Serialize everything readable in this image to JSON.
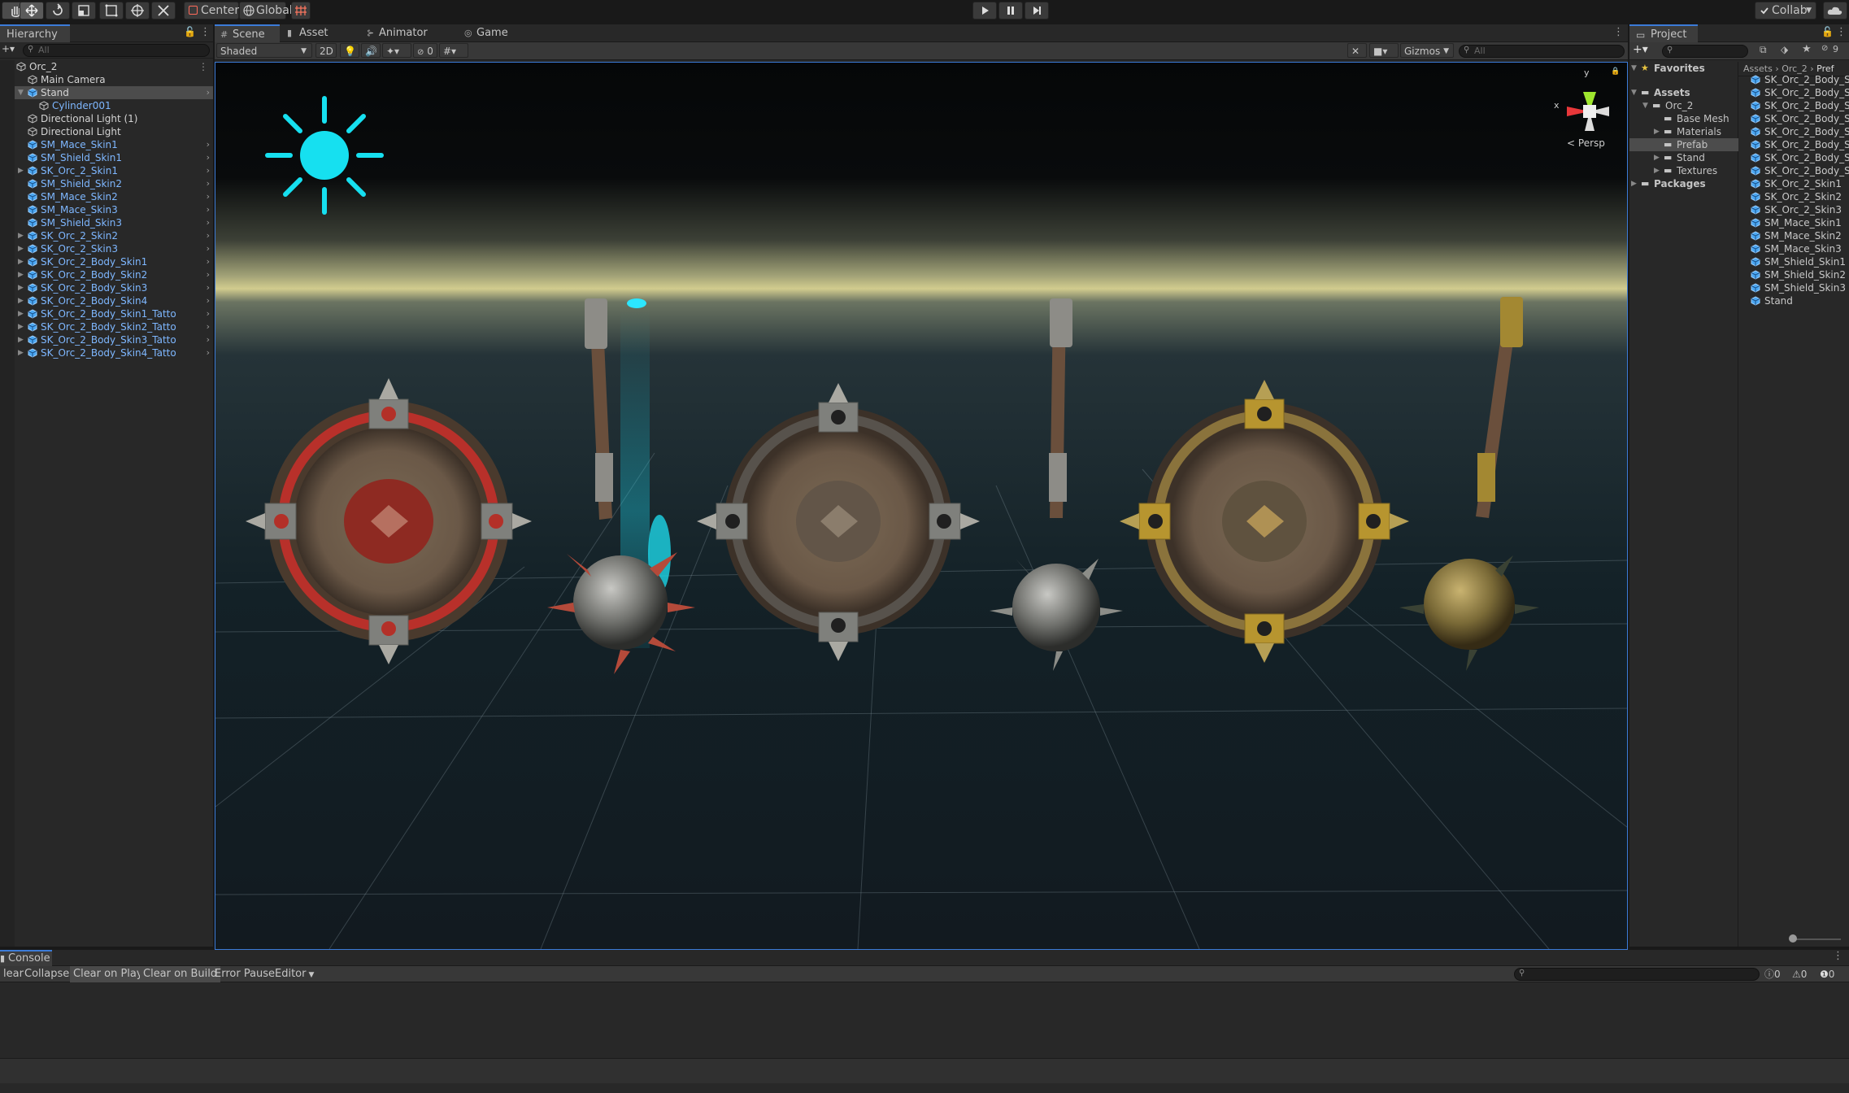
{
  "toolbar": {
    "tools": [
      "hand-tool",
      "move-tool",
      "rotate-tool",
      "scale-tool",
      "rect-tool",
      "transform-tool",
      "custom-tool"
    ],
    "pivot_label": "Center",
    "space_label": "Global",
    "collab_label": "Collab"
  },
  "hierarchy": {
    "tab_label": "Hierarchy",
    "search_placeholder": "All",
    "items": [
      {
        "label": "Orc_2",
        "indent": 0,
        "color": "white",
        "fold": "open",
        "icon": "scene"
      },
      {
        "label": "Main Camera",
        "indent": 1,
        "color": "white",
        "fold": "",
        "icon": "gameobject"
      },
      {
        "label": "Stand",
        "indent": 1,
        "color": "white",
        "fold": "open",
        "icon": "prefab",
        "selected": true,
        "arrow": true
      },
      {
        "label": "Cylinder001",
        "indent": 2,
        "color": "blue",
        "fold": "",
        "icon": "gameobject"
      },
      {
        "label": "Directional Light (1)",
        "indent": 1,
        "color": "white",
        "fold": "",
        "icon": "gameobject"
      },
      {
        "label": "Directional Light",
        "indent": 1,
        "color": "white",
        "fold": "",
        "icon": "gameobject"
      },
      {
        "label": "SM_Mace_Skin1",
        "indent": 1,
        "color": "blue",
        "fold": "",
        "icon": "prefab",
        "arrow": true
      },
      {
        "label": "SM_Shield_Skin1",
        "indent": 1,
        "color": "blue",
        "fold": "",
        "icon": "prefab",
        "arrow": true
      },
      {
        "label": "SK_Orc_2_Skin1",
        "indent": 1,
        "color": "blue",
        "fold": "closed",
        "icon": "prefab",
        "arrow": true
      },
      {
        "label": "SM_Shield_Skin2",
        "indent": 1,
        "color": "blue",
        "fold": "",
        "icon": "prefab",
        "arrow": true
      },
      {
        "label": "SM_Mace_Skin2",
        "indent": 1,
        "color": "blue",
        "fold": "",
        "icon": "prefab",
        "arrow": true
      },
      {
        "label": "SM_Mace_Skin3",
        "indent": 1,
        "color": "blue",
        "fold": "",
        "icon": "prefab",
        "arrow": true
      },
      {
        "label": "SM_Shield_Skin3",
        "indent": 1,
        "color": "blue",
        "fold": "",
        "icon": "prefab",
        "arrow": true
      },
      {
        "label": "SK_Orc_2_Skin2",
        "indent": 1,
        "color": "blue",
        "fold": "closed",
        "icon": "prefab",
        "arrow": true
      },
      {
        "label": "SK_Orc_2_Skin3",
        "indent": 1,
        "color": "blue",
        "fold": "closed",
        "icon": "prefab",
        "arrow": true
      },
      {
        "label": "SK_Orc_2_Body_Skin1",
        "indent": 1,
        "color": "blue",
        "fold": "closed",
        "icon": "prefab",
        "arrow": true
      },
      {
        "label": "SK_Orc_2_Body_Skin2",
        "indent": 1,
        "color": "blue",
        "fold": "closed",
        "icon": "prefab",
        "arrow": true
      },
      {
        "label": "SK_Orc_2_Body_Skin3",
        "indent": 1,
        "color": "blue",
        "fold": "closed",
        "icon": "prefab",
        "arrow": true
      },
      {
        "label": "SK_Orc_2_Body_Skin4",
        "indent": 1,
        "color": "blue",
        "fold": "closed",
        "icon": "prefab",
        "arrow": true
      },
      {
        "label": "SK_Orc_2_Body_Skin1_Tatto",
        "indent": 1,
        "color": "blue",
        "fold": "closed",
        "icon": "prefab",
        "arrow": true
      },
      {
        "label": "SK_Orc_2_Body_Skin2_Tatto",
        "indent": 1,
        "color": "blue",
        "fold": "closed",
        "icon": "prefab",
        "arrow": true
      },
      {
        "label": "SK_Orc_2_Body_Skin3_Tatto",
        "indent": 1,
        "color": "blue",
        "fold": "closed",
        "icon": "prefab",
        "arrow": true
      },
      {
        "label": "SK_Orc_2_Body_Skin4_Tatto",
        "indent": 1,
        "color": "blue",
        "fold": "closed",
        "icon": "prefab",
        "arrow": true
      }
    ]
  },
  "scene": {
    "tabs": [
      {
        "label": "Scene",
        "icon": "grid-icon",
        "active": true
      },
      {
        "label": "Asset Store",
        "icon": "store-icon",
        "active": false
      },
      {
        "label": "Animator",
        "icon": "animator-icon",
        "active": false
      },
      {
        "label": "Game",
        "icon": "game-icon",
        "active": false
      }
    ],
    "shading_mode": "Shaded",
    "mode_2d_label": "2D",
    "hidden_count": "0",
    "gizmos_label": "Gizmos",
    "search_placeholder": "All",
    "gizmo_axes": {
      "x": "x",
      "y": "y"
    },
    "projection_label": "Persp"
  },
  "project": {
    "tab_label": "Project",
    "badge_count": "9",
    "breadcrumb": [
      "Assets",
      "Orc_2",
      "Pref"
    ],
    "tree": [
      {
        "label": "Favorites",
        "indent": 0,
        "bold": true,
        "icon": "star-icon",
        "fold": "open"
      },
      {
        "label": "Assets",
        "indent": 0,
        "bold": true,
        "icon": "folder-icon",
        "fold": "open"
      },
      {
        "label": "Orc_2",
        "indent": 1,
        "bold": false,
        "icon": "folder-icon",
        "fold": "open"
      },
      {
        "label": "Base Mesh",
        "indent": 2,
        "bold": false,
        "icon": "folder-icon",
        "fold": ""
      },
      {
        "label": "Materials",
        "indent": 2,
        "bold": false,
        "icon": "folder-icon",
        "fold": "closed"
      },
      {
        "label": "Prefab",
        "indent": 2,
        "bold": false,
        "icon": "folder-icon",
        "fold": "",
        "selected": true
      },
      {
        "label": "Stand",
        "indent": 2,
        "bold": false,
        "icon": "folder-icon",
        "fold": "closed"
      },
      {
        "label": "Textures",
        "indent": 2,
        "bold": false,
        "icon": "folder-icon",
        "fold": "closed"
      },
      {
        "label": "Packages",
        "indent": 0,
        "bold": true,
        "icon": "folder-icon",
        "fold": "closed"
      }
    ],
    "assets": [
      "SK_Orc_2_Body_S",
      "SK_Orc_2_Body_S",
      "SK_Orc_2_Body_S",
      "SK_Orc_2_Body_S",
      "SK_Orc_2_Body_S",
      "SK_Orc_2_Body_S",
      "SK_Orc_2_Body_S",
      "SK_Orc_2_Body_S",
      "SK_Orc_2_Skin1",
      "SK_Orc_2_Skin2",
      "SK_Orc_2_Skin3",
      "SM_Mace_Skin1",
      "SM_Mace_Skin2",
      "SM_Mace_Skin3",
      "SM_Shield_Skin1",
      "SM_Shield_Skin2",
      "SM_Shield_Skin3",
      "Stand"
    ]
  },
  "console": {
    "tab_label": "Console",
    "buttons": [
      {
        "label": "lear",
        "on": false
      },
      {
        "label": "Collapse",
        "on": false
      },
      {
        "label": "Clear on Play",
        "on": true
      },
      {
        "label": "Clear on Build",
        "on": true
      },
      {
        "label": "Error Pause",
        "on": false
      },
      {
        "label": "Editor",
        "on": false,
        "dropdown": true
      }
    ],
    "log_count": "0",
    "warning_count": "0",
    "error_count": "0"
  },
  "colors": {
    "accent_blue": "#3b7bd8",
    "prefab_text": "#7eb7ff",
    "sun_icon": "#16e0f0"
  }
}
